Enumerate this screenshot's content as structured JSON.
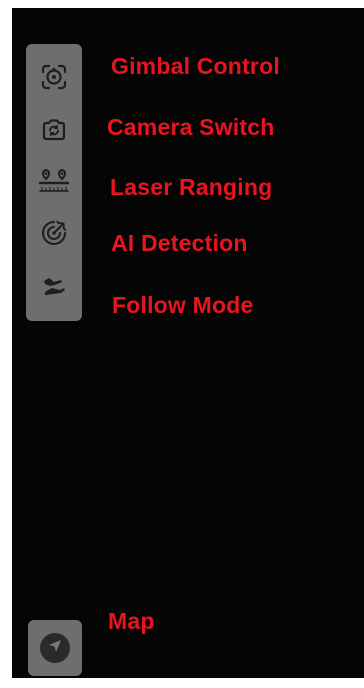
{
  "toolbar": {
    "items": [
      {
        "label": "Gimbal Control",
        "icon": "gimbal-control-icon"
      },
      {
        "label": "Camera Switch",
        "icon": "camera-switch-icon"
      },
      {
        "label": "Laser Ranging",
        "icon": "laser-ranging-icon"
      },
      {
        "label": "AI Detection",
        "icon": "ai-detection-icon"
      },
      {
        "label": "Follow Mode",
        "icon": "follow-mode-icon"
      }
    ]
  },
  "map": {
    "label": "Map",
    "icon": "send-arrow-icon"
  },
  "colors": {
    "label": "#e8141e",
    "panel": "#6e6e6e",
    "background": "#050505",
    "icon": "#1e1e1e"
  }
}
